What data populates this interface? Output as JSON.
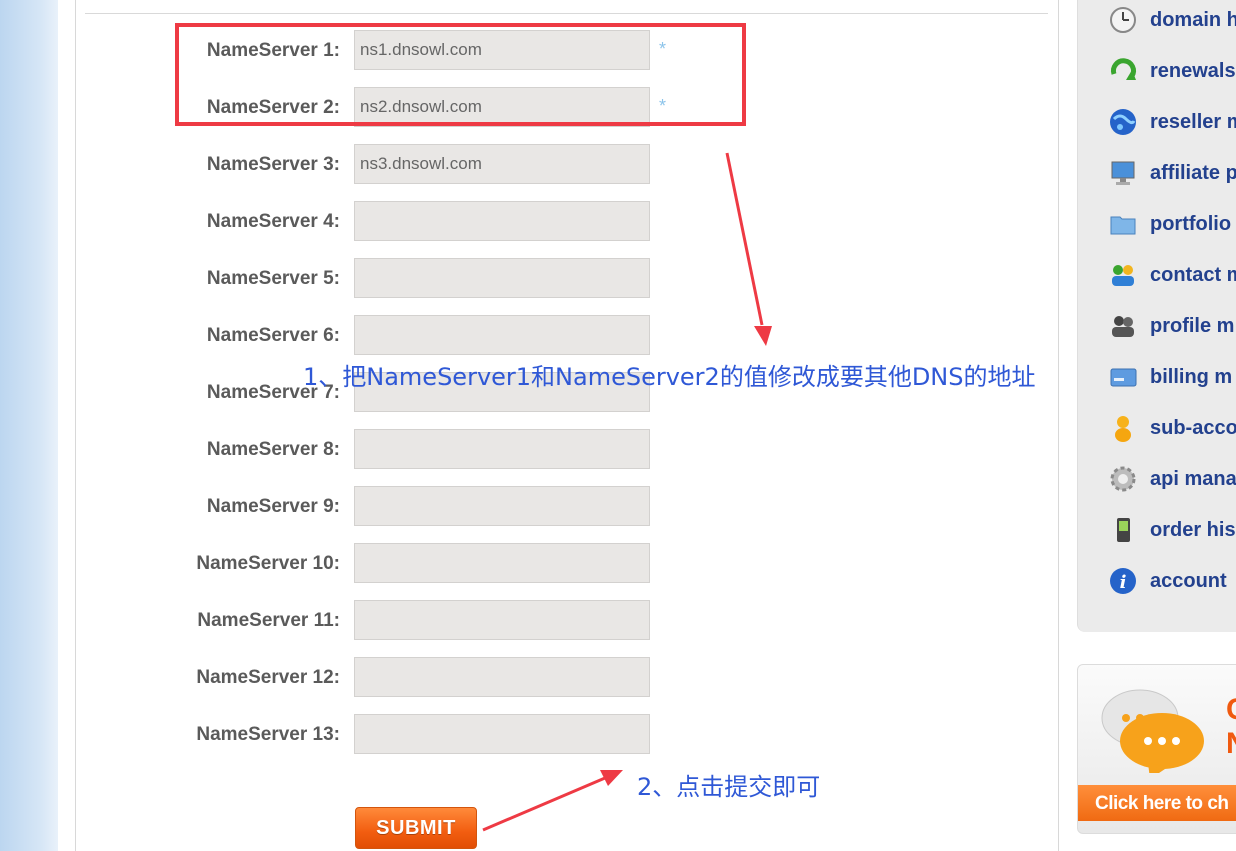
{
  "nameservers": [
    {
      "label": "NameServer 1:",
      "value": "ns1.dnsowl.com",
      "required": true
    },
    {
      "label": "NameServer 2:",
      "value": "ns2.dnsowl.com",
      "required": true
    },
    {
      "label": "NameServer 3:",
      "value": "ns3.dnsowl.com",
      "required": false
    },
    {
      "label": "NameServer 4:",
      "value": "",
      "required": false
    },
    {
      "label": "NameServer 5:",
      "value": "",
      "required": false
    },
    {
      "label": "NameServer 6:",
      "value": "",
      "required": false
    },
    {
      "label": "NameServer 7:",
      "value": "",
      "required": false
    },
    {
      "label": "NameServer 8:",
      "value": "",
      "required": false
    },
    {
      "label": "NameServer 9:",
      "value": "",
      "required": false
    },
    {
      "label": "NameServer 10:",
      "value": "",
      "required": false
    },
    {
      "label": "NameServer 11:",
      "value": "",
      "required": false
    },
    {
      "label": "NameServer 12:",
      "value": "",
      "required": false
    },
    {
      "label": "NameServer 13:",
      "value": "",
      "required": false
    }
  ],
  "required_marker": "*",
  "submit_label": "SUBMIT",
  "annotations": {
    "step1": "1、把NameServer1和NameServer2的值修改成要其他DNS的地址",
    "step2": "2、点击提交即可",
    "highlight_color": "#ee3a44",
    "text_color": "#2f58d6"
  },
  "sidebar": {
    "items": [
      {
        "label": "domain h",
        "icon": "clock-icon"
      },
      {
        "label": "renewals",
        "icon": "renew-arrow-icon"
      },
      {
        "label": "reseller m",
        "icon": "globe-icon"
      },
      {
        "label": "affiliate p",
        "icon": "monitor-icon"
      },
      {
        "label": "portfolio",
        "icon": "folder-icon"
      },
      {
        "label": "contact m",
        "icon": "contacts-icon"
      },
      {
        "label": "profile m",
        "icon": "users-icon"
      },
      {
        "label": "billing m",
        "icon": "credit-card-icon"
      },
      {
        "label": "sub-acco",
        "icon": "person-icon"
      },
      {
        "label": "api mana",
        "icon": "gear-icon"
      },
      {
        "label": "order his",
        "icon": "phone-icon"
      },
      {
        "label": "account",
        "icon": "info-icon"
      }
    ]
  },
  "chat_banner": {
    "headline": "C\nN",
    "cta": "Click here to ch"
  }
}
